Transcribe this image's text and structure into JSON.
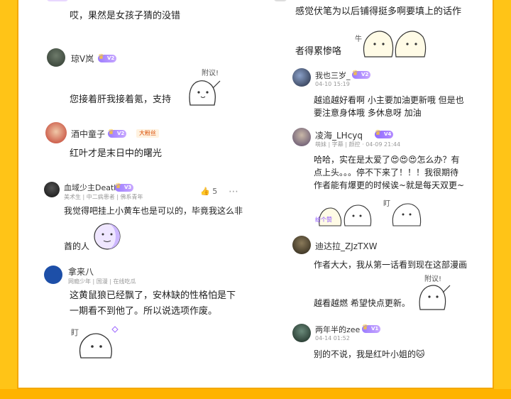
{
  "left": [
    {
      "text1": "哎，果然是女孩子猜的没错"
    },
    {
      "name": "琼V岚",
      "level": "V2",
      "text1": "您接着肝我接着氪，支持",
      "sticker": "附议!"
    },
    {
      "name": "酒中童子",
      "level": "V2",
      "tag": "大粉丝",
      "text1": "红叶才是末日中的曙光"
    },
    {
      "name": "血域少主Death",
      "level": "V3",
      "sub": "美术生 | 中二病患者 | 佛系青年",
      "text1": "我觉得吧挂上小黄车也是可以的，毕竟我这么非",
      "text2": "酋的人",
      "likes": "5"
    },
    {
      "name": "拿来八",
      "sub": "网瘾少年 | 国漫 | 在线吃瓜",
      "text1": "这黄鼠狼已经飘了，安林缺的性格怕是下",
      "text2": "一期看不到他了。所以说选项作废。",
      "sticker": "盯"
    }
  ],
  "right": [
    {
      "text1": "感觉伏笔为以后铺得挺多啊要填上的话作",
      "text2": "者得累惨咯",
      "sticker": "牛"
    },
    {
      "name": "我也三岁_",
      "level": "V2",
      "sub": "04-10 15:19",
      "text1": "越追越好看啊 小主要加油更新哦 但是也",
      "text2": "要注意身体哦 多休息呀 加油"
    },
    {
      "name": "凌海_LHcyq",
      "level": "V4",
      "sub": "萌妹 | 字幕 | 颜控 · 04-09 21:44",
      "text1": "哈哈，实在是太爱了😍😍😍怎么办？有",
      "text2": "点上头。。。停不下来了！！！我很期待",
      "text3": "作者能有爆更的时候诶~就是每天双更~",
      "sticker1": "给个赞",
      "sticker2": "盯"
    },
    {
      "name": "迪达拉_ZJzTXW",
      "text1": "作者大大，我从第一话看到现在这部漫画",
      "text2": "越看越燃 希望快点更新。",
      "sticker": "附议!"
    },
    {
      "name": "两年半的zee",
      "level": "V1",
      "sub": "04-14 01:52",
      "text1": "别的不说，我是红叶小姐的🐱"
    }
  ],
  "colors": {
    "background": "#ffc417",
    "level": "#9b7cff",
    "text": "#222222"
  }
}
